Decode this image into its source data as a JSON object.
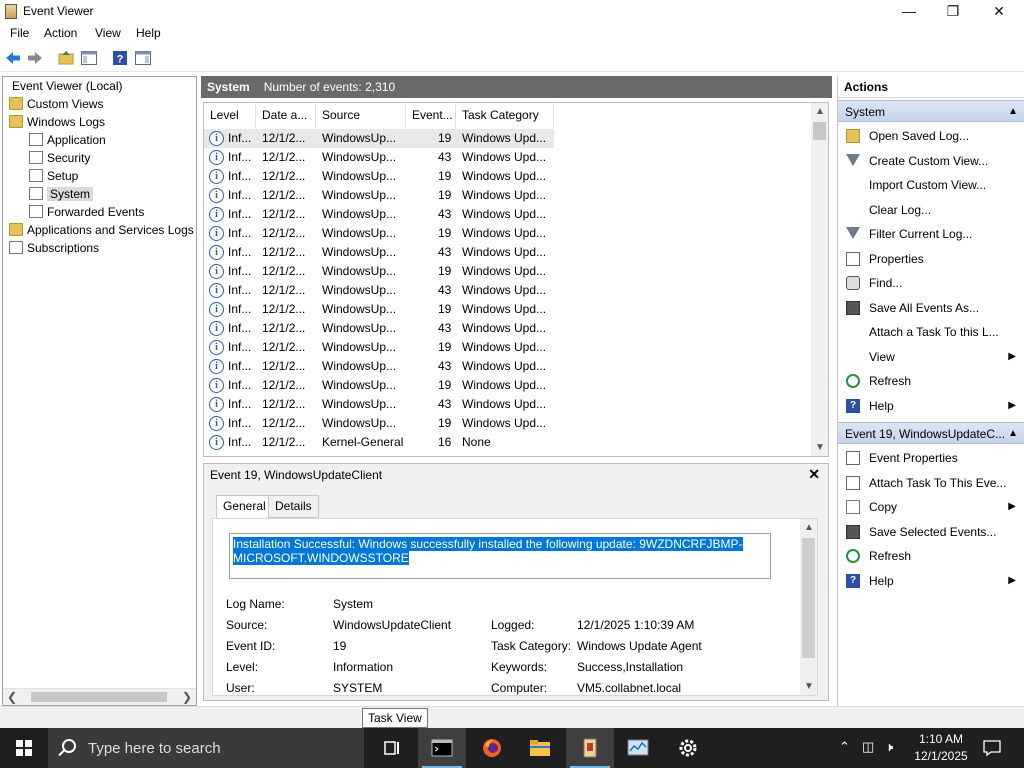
{
  "window": {
    "title": "Event Viewer",
    "minimize_glyph": "—",
    "maximize_glyph": "❐",
    "close_glyph": "✕"
  },
  "menu": [
    "File",
    "Action",
    "View",
    "Help"
  ],
  "tree": {
    "root": "Event Viewer (Local)",
    "items": [
      {
        "label": "Custom Views",
        "icon": "folder-icon"
      },
      {
        "label": "Windows Logs",
        "icon": "folder-icon"
      },
      {
        "label": "Application",
        "icon": "log-icon"
      },
      {
        "label": "Security",
        "icon": "log-icon"
      },
      {
        "label": "Setup",
        "icon": "log-icon"
      },
      {
        "label": "System",
        "icon": "log-icon"
      },
      {
        "label": "Forwarded Events",
        "icon": "log-icon"
      },
      {
        "label": "Applications and Services Logs",
        "icon": "folder-icon"
      },
      {
        "label": "Subscriptions",
        "icon": "subscriptions-icon"
      }
    ],
    "selected": "System"
  },
  "center": {
    "log_name": "System",
    "event_count": "Number of events: 2,310"
  },
  "columns": [
    "Level",
    "Date a...",
    "Source",
    "Event...",
    "Task Category"
  ],
  "events": [
    {
      "level": "Inf...",
      "date": "12/1/2...",
      "source": "WindowsUp...",
      "id": "19",
      "category": "Windows Upd..."
    },
    {
      "level": "Inf...",
      "date": "12/1/2...",
      "source": "WindowsUp...",
      "id": "43",
      "category": "Windows Upd..."
    },
    {
      "level": "Inf...",
      "date": "12/1/2...",
      "source": "WindowsUp...",
      "id": "19",
      "category": "Windows Upd..."
    },
    {
      "level": "Inf...",
      "date": "12/1/2...",
      "source": "WindowsUp...",
      "id": "19",
      "category": "Windows Upd..."
    },
    {
      "level": "Inf...",
      "date": "12/1/2...",
      "source": "WindowsUp...",
      "id": "43",
      "category": "Windows Upd..."
    },
    {
      "level": "Inf...",
      "date": "12/1/2...",
      "source": "WindowsUp...",
      "id": "19",
      "category": "Windows Upd..."
    },
    {
      "level": "Inf...",
      "date": "12/1/2...",
      "source": "WindowsUp...",
      "id": "43",
      "category": "Windows Upd..."
    },
    {
      "level": "Inf...",
      "date": "12/1/2...",
      "source": "WindowsUp...",
      "id": "19",
      "category": "Windows Upd..."
    },
    {
      "level": "Inf...",
      "date": "12/1/2...",
      "source": "WindowsUp...",
      "id": "43",
      "category": "Windows Upd..."
    },
    {
      "level": "Inf...",
      "date": "12/1/2...",
      "source": "WindowsUp...",
      "id": "19",
      "category": "Windows Upd..."
    },
    {
      "level": "Inf...",
      "date": "12/1/2...",
      "source": "WindowsUp...",
      "id": "43",
      "category": "Windows Upd..."
    },
    {
      "level": "Inf...",
      "date": "12/1/2...",
      "source": "WindowsUp...",
      "id": "19",
      "category": "Windows Upd..."
    },
    {
      "level": "Inf...",
      "date": "12/1/2...",
      "source": "WindowsUp...",
      "id": "43",
      "category": "Windows Upd..."
    },
    {
      "level": "Inf...",
      "date": "12/1/2...",
      "source": "WindowsUp...",
      "id": "19",
      "category": "Windows Upd..."
    },
    {
      "level": "Inf...",
      "date": "12/1/2...",
      "source": "WindowsUp...",
      "id": "43",
      "category": "Windows Upd..."
    },
    {
      "level": "Inf...",
      "date": "12/1/2...",
      "source": "WindowsUp...",
      "id": "19",
      "category": "Windows Upd..."
    },
    {
      "level": "Inf...",
      "date": "12/1/2...",
      "source": "Kernel-General",
      "id": "16",
      "category": "None"
    }
  ],
  "detail": {
    "title": "Event 19, WindowsUpdateClient",
    "close_glyph": "✕",
    "tabs": [
      "General",
      "Details"
    ],
    "description": "Installation Successful: Windows successfully installed the following update: 9WZDNCRFJBMP-MICROSOFT.WINDOWSSTORE",
    "props": {
      "log_name_label": "Log Name:",
      "log_name": "System",
      "source_label": "Source:",
      "source": "WindowsUpdateClient",
      "logged_label": "Logged:",
      "logged": "12/1/2025 1:10:39 AM",
      "event_id_label": "Event ID:",
      "event_id": "19",
      "task_category_label": "Task Category:",
      "task_category": "Windows Update Agent",
      "level_label": "Level:",
      "level": "Information",
      "keywords_label": "Keywords:",
      "keywords": "Success,Installation",
      "user_label": "User:",
      "user": "SYSTEM",
      "computer_label": "Computer:",
      "computer": "VM5.collabnet.local"
    }
  },
  "actions": {
    "title": "Actions",
    "section1": "System",
    "section1_items": [
      {
        "label": "Open Saved Log...",
        "icon": "open-log-icon"
      },
      {
        "label": "Create Custom View...",
        "icon": "filter-icon"
      },
      {
        "label": "Import Custom View...",
        "icon": ""
      },
      {
        "label": "Clear Log...",
        "icon": ""
      },
      {
        "label": "Filter Current Log...",
        "icon": "filter-icon"
      },
      {
        "label": "Properties",
        "icon": "properties-icon"
      },
      {
        "label": "Find...",
        "icon": "find-icon"
      },
      {
        "label": "Save All Events As...",
        "icon": "save-icon"
      },
      {
        "label": "Attach a Task To this L...",
        "icon": ""
      },
      {
        "label": "View",
        "icon": "",
        "submenu": true
      },
      {
        "label": "Refresh",
        "icon": "refresh-icon"
      },
      {
        "label": "Help",
        "icon": "help-icon",
        "submenu": true
      }
    ],
    "section2": "Event 19, WindowsUpdateC...",
    "section2_items": [
      {
        "label": "Event Properties",
        "icon": "properties-icon"
      },
      {
        "label": "Attach Task To This Eve...",
        "icon": "task-icon"
      },
      {
        "label": "Copy",
        "icon": "copy-icon",
        "submenu": true
      },
      {
        "label": "Save Selected Events...",
        "icon": "save-icon"
      },
      {
        "label": "Refresh",
        "icon": "refresh-icon"
      },
      {
        "label": "Help",
        "icon": "help-icon",
        "submenu": true
      }
    ]
  },
  "tooltip": "Task View",
  "taskbar": {
    "search_placeholder": "Type here to search",
    "time": "1:10 AM",
    "date": "12/1/2025"
  },
  "colors": {
    "selection": "#0078d7",
    "header_bg": "#6a6a6a",
    "taskbar_bg": "#1f1f1f",
    "section_bg": "#c4d4ea"
  }
}
